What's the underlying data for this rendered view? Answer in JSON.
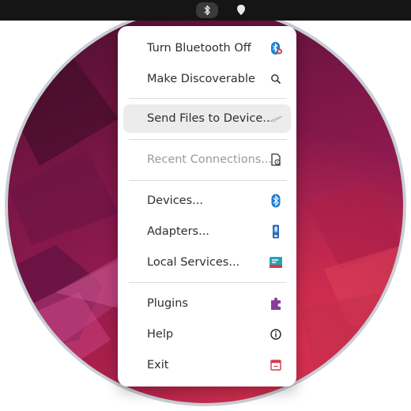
{
  "menu": {
    "items": [
      {
        "label": "Turn Bluetooth Off",
        "icon": "bluetooth-off-icon"
      },
      {
        "label": "Make Discoverable",
        "icon": "search-icon"
      },
      {
        "label": "Send Files to Device...",
        "icon": "send-icon",
        "highlighted": true
      },
      {
        "label": "Recent Connections...",
        "icon": "document-clock-icon",
        "disabled": true
      },
      {
        "label": "Devices...",
        "icon": "bluetooth-icon"
      },
      {
        "label": "Adapters...",
        "icon": "adapter-icon"
      },
      {
        "label": "Local Services...",
        "icon": "services-icon"
      },
      {
        "label": "Plugins",
        "icon": "puzzle-icon"
      },
      {
        "label": "Help",
        "icon": "info-icon"
      },
      {
        "label": "Exit",
        "icon": "exit-icon"
      }
    ]
  },
  "colors": {
    "bluetooth": "#1f7fd6",
    "exit": "#d43c4a",
    "plugin": "#8a3d9a"
  }
}
